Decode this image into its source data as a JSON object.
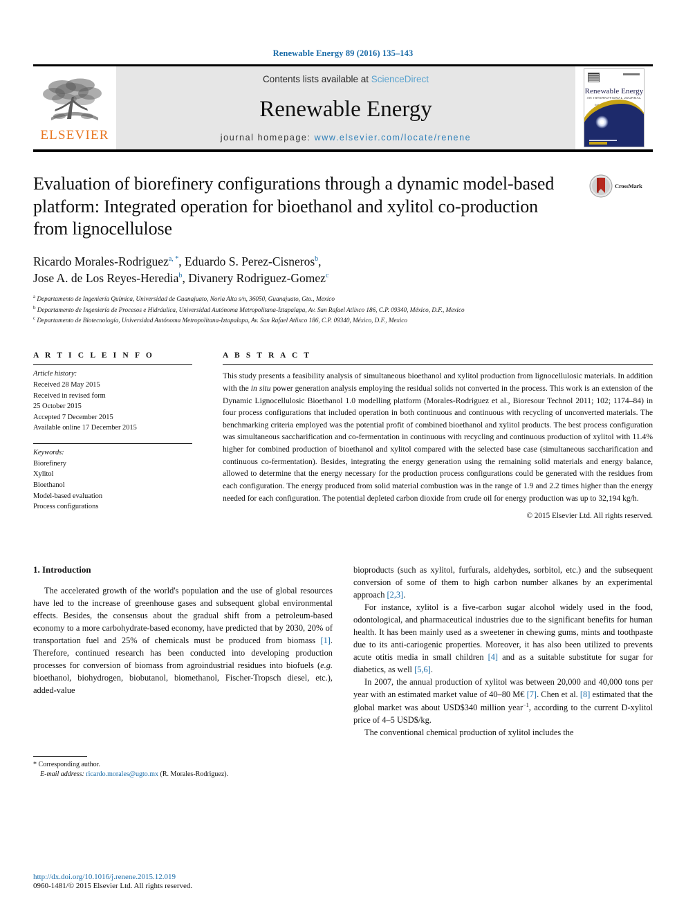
{
  "running_head": "Renewable Energy 89 (2016) 135–143",
  "masthead": {
    "publisher_name": "ELSEVIER",
    "contents_prefix": "Contents lists available at ",
    "sciencedirect": "ScienceDirect",
    "journal_name": "Renewable Energy",
    "homepage_prefix": "journal homepage: ",
    "homepage_url": "www.elsevier.com/locate/renene",
    "cover": {
      "title": "Renewable Energy",
      "subtitle": "AN INTERNATIONAL JOURNAL",
      "tagline": "Editor-in-Chief: Soteris A. Kalogirou"
    }
  },
  "article": {
    "title": "Evaluation of biorefinery configurations through a dynamic model-based platform: Integrated operation for bioethanol and xylitol co-production from lignocellulose",
    "crossmark_label": "CrossMark",
    "authors_line_1": "Ricardo Morales-Rodriguez",
    "authors_line_1_sup": "a, *",
    "authors_line_1b": ", Eduardo S. Perez-Cisneros",
    "authors_line_1b_sup": "b",
    "authors_line_2": "Jose A. de Los Reyes-Heredia",
    "authors_line_2_sup": "b",
    "authors_line_2b": ", Divanery Rodriguez-Gomez",
    "authors_line_2b_sup": "c",
    "affiliations": [
      {
        "marker": "a",
        "text": "Departamento de Ingeniería Química, Universidad de Guanajuato, Noria Alta s/n, 36050, Guanajuato, Gto., Mexico"
      },
      {
        "marker": "b",
        "text": "Departamento de Ingeniería de Procesos e Hidráulica, Universidad Autónoma Metropolitana-Iztapalapa, Av. San Rafael Atlixco 186, C.P. 09340, México, D.F., Mexico"
      },
      {
        "marker": "c",
        "text": "Departamento de Biotecnología, Universidad Autónoma Metropolitana-Iztapalapa, Av. San Rafael Atlixco 186, C.P. 09340, México, D.F., Mexico"
      }
    ]
  },
  "article_info": {
    "heading": "A R T I C L E   I N F O",
    "history_label": "Article history:",
    "history": [
      "Received 28 May 2015",
      "Received in revised form",
      "25 October 2015",
      "Accepted 7 December 2015",
      "Available online 17 December 2015"
    ],
    "keywords_label": "Keywords:",
    "keywords": [
      "Biorefinery",
      "Xylitol",
      "Bioethanol",
      "Model-based evaluation",
      "Process configurations"
    ]
  },
  "abstract": {
    "heading": "A B S T R A C T",
    "p1_a": "This study presents a feasibility analysis of simultaneous bioethanol and xylitol production from lignocellulosic materials. In addition with the ",
    "p1_italic": "in situ",
    "p1_b": " power generation analysis employing the residual solids not converted in the process. This work is an extension of the Dynamic Lignocellulosic Bioethanol 1.0 modelling platform (Morales-Rodriguez et al., Bioresour Technol 2011; 102; 1174–84) in four process configurations that included operation in both continuous and continuous with recycling of unconverted materials. The benchmarking criteria employed was the potential profit of combined bioethanol and xylitol products. The best process configuration was simultaneous saccharification and co-fermentation in continuous with recycling and continuous production of xylitol with 11.4% higher for combined production of bioethanol and xylitol compared with the selected base case (simultaneous saccharification and continuous co-fermentation). Besides, integrating the energy generation using the remaining solid materials and energy balance, allowed to determine that the energy necessary for the production process configurations could be generated with the residues from each configuration. The energy produced from solid material combustion was in the range of 1.9 and 2.2 times higher than the energy needed for each configuration. The potential depleted carbon dioxide from crude oil for energy production was up to 32,194 kg/h.",
    "copyright": "© 2015 Elsevier Ltd. All rights reserved."
  },
  "introduction": {
    "heading": "1.  Introduction",
    "left_p1_a": "The accelerated growth of the world's population and the use of global resources have led to the increase of greenhouse gases and subsequent global environmental effects. Besides, the consensus about the gradual shift from a petroleum-based economy to a more carbohydrate-based economy, have predicted that by 2030, 20% of transportation fuel and 25% of chemicals must be produced from biomass ",
    "left_p1_ref": "[1]",
    "left_p1_b": ". Therefore, continued research has been conducted into developing production processes for conversion of biomass from agroindustrial residues into biofuels (",
    "left_p1_italic": "e.g.",
    "left_p1_c": " bioethanol, biohydrogen, biobutanol, biomethanol, Fischer-Tropsch diesel, etc.), added-value",
    "right_p1_a": "bioproducts (such as xylitol, furfurals, aldehydes, sorbitol, etc.) and the subsequent conversion of some of them to high carbon number alkanes by an experimental approach ",
    "right_p1_ref": "[2,3]",
    "right_p1_b": ".",
    "right_p2_a": "For instance, xylitol is a five-carbon sugar alcohol widely used in the food, odontological, and pharmaceutical industries due to the significant benefits for human health. It has been mainly used as a sweetener in chewing gums, mints and toothpaste due to its anti-cariogenic properties. Moreover, it has also been utilized to prevents acute otitis media in small children ",
    "right_p2_ref1": "[4]",
    "right_p2_b": " and as a suitable substitute for sugar for diabetics, as well ",
    "right_p2_ref2": "[5,6]",
    "right_p2_c": ".",
    "right_p3_a": "In 2007, the annual production of xylitol was between 20,000 and 40,000 tons per year with an estimated market value of 40–80 M€ ",
    "right_p3_ref1": "[7]",
    "right_p3_b": ". Chen et al. ",
    "right_p3_ref2": "[8]",
    "right_p3_c": " estimated that the global market was about USD$340 million year",
    "right_p3_sup": "−1",
    "right_p3_d": ", according to the current D-xylitol price of 4–5 USD$/kg.",
    "right_p4": "The conventional chemical production of xylitol includes the"
  },
  "footnote": {
    "corresponding": "* Corresponding author.",
    "email_label": "E-mail address:",
    "email": "ricardo.morales@ugto.mx",
    "email_suffix": " (R. Morales-Rodriguez)."
  },
  "footer": {
    "doi": "http://dx.doi.org/10.1016/j.renene.2015.12.019",
    "issn_line": "0960-1481/© 2015 Elsevier Ltd. All rights reserved."
  },
  "colors": {
    "link_blue": "#1b6ca8",
    "sciencedirect_blue": "#5ba3cf",
    "elsevier_orange": "#e87722",
    "masthead_grey": "#e6e6e6",
    "cover_navy": "#1d2a6b",
    "cover_gold": "#c8a415",
    "crossmark_red": "#b5281e"
  }
}
